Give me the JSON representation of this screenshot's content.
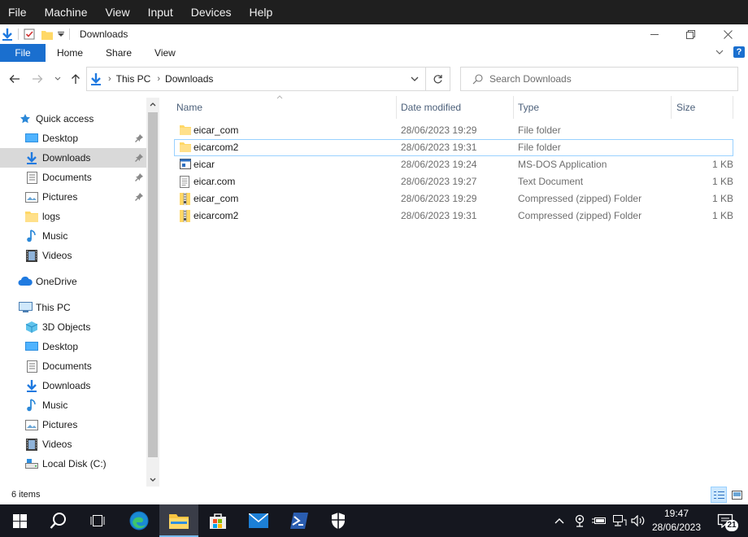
{
  "vm_menu": [
    "File",
    "Machine",
    "View",
    "Input",
    "Devices",
    "Help"
  ],
  "window": {
    "title": "Downloads"
  },
  "ribbon": {
    "tabs": [
      "File",
      "Home",
      "Share",
      "View"
    ]
  },
  "address": {
    "crumbs": [
      "This PC",
      "Downloads"
    ]
  },
  "search": {
    "placeholder": "Search Downloads"
  },
  "nav": {
    "quick_access": "Quick access",
    "quick_items": [
      {
        "label": "Desktop",
        "icon": "desktop-icon",
        "pinned": true
      },
      {
        "label": "Downloads",
        "icon": "download-icon",
        "pinned": true,
        "selected": true
      },
      {
        "label": "Documents",
        "icon": "documents-icon",
        "pinned": true
      },
      {
        "label": "Pictures",
        "icon": "pictures-icon",
        "pinned": true
      },
      {
        "label": "logs",
        "icon": "folder-icon"
      },
      {
        "label": "Music",
        "icon": "music-icon"
      },
      {
        "label": "Videos",
        "icon": "videos-icon"
      }
    ],
    "onedrive": "OneDrive",
    "this_pc": "This PC",
    "pc_items": [
      {
        "label": "3D Objects",
        "icon": "3d-objects-icon"
      },
      {
        "label": "Desktop",
        "icon": "desktop-icon"
      },
      {
        "label": "Documents",
        "icon": "documents-icon"
      },
      {
        "label": "Downloads",
        "icon": "download-icon"
      },
      {
        "label": "Music",
        "icon": "music-icon"
      },
      {
        "label": "Pictures",
        "icon": "pictures-icon"
      },
      {
        "label": "Videos",
        "icon": "videos-icon"
      },
      {
        "label": "Local Disk (C:)",
        "icon": "drive-icon"
      }
    ]
  },
  "columns": {
    "name": "Name",
    "date": "Date modified",
    "type": "Type",
    "size": "Size"
  },
  "files": [
    {
      "name": "eicar_com",
      "date": "28/06/2023 19:29",
      "type": "File folder",
      "size": "",
      "icon": "folder-icon"
    },
    {
      "name": "eicarcom2",
      "date": "28/06/2023 19:31",
      "type": "File folder",
      "size": "",
      "icon": "folder-icon",
      "focused": true
    },
    {
      "name": "eicar",
      "date": "28/06/2023 19:24",
      "type": "MS-DOS Application",
      "size": "1 KB",
      "icon": "application-icon"
    },
    {
      "name": "eicar.com",
      "date": "28/06/2023 19:27",
      "type": "Text Document",
      "size": "1 KB",
      "icon": "text-document-icon"
    },
    {
      "name": "eicar_com",
      "date": "28/06/2023 19:29",
      "type": "Compressed (zipped) Folder",
      "size": "1 KB",
      "icon": "zip-folder-icon"
    },
    {
      "name": "eicarcom2",
      "date": "28/06/2023 19:31",
      "type": "Compressed (zipped) Folder",
      "size": "1 KB",
      "icon": "zip-folder-icon"
    }
  ],
  "status": {
    "count": "6 items"
  },
  "clock": {
    "time": "19:47",
    "date": "28/06/2023"
  },
  "notifications": {
    "count": "21"
  },
  "colors": {
    "accent": "#1a6fcf",
    "selection": "#d9d9d9",
    "focus_border": "#99d1ff",
    "taskbar": "#15171f",
    "folder": "#ffd866"
  }
}
